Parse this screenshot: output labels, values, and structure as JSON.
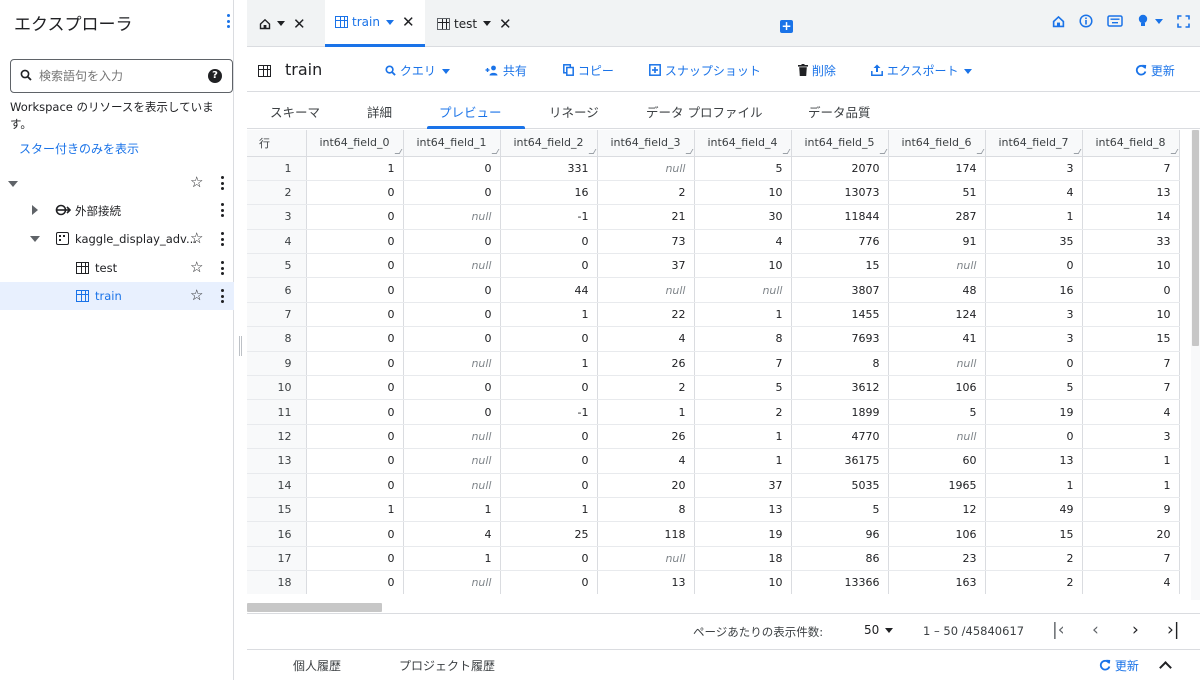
{
  "explorer": {
    "title": "エクスプローラ",
    "search_placeholder": "検索語句を入力",
    "workspace_text": "Workspace のリソースを表示しています。",
    "starred_link": "スター付きのみを表示",
    "tree": [
      {
        "label": "",
        "level": 0,
        "expanded": true
      },
      {
        "label": "外部接続",
        "level": 1,
        "expanded": false
      },
      {
        "label": "kaggle_display_adv...",
        "level": 1,
        "expanded": true
      },
      {
        "label": "test",
        "level": 2
      },
      {
        "label": "train",
        "level": 2,
        "selected": true
      }
    ]
  },
  "tabs": [
    {
      "label": "",
      "icon": "home-icon"
    },
    {
      "label": "train",
      "active": true
    },
    {
      "label": "test"
    }
  ],
  "toolbar": {
    "title": "train",
    "query": "クエリ",
    "share": "共有",
    "copy": "コピー",
    "snapshot": "スナップショット",
    "delete": "削除",
    "export": "エクスポート",
    "refresh": "更新"
  },
  "subtabs": [
    "スキーマ",
    "詳細",
    "プレビュー",
    "リネージ",
    "データ プロファイル",
    "データ品質"
  ],
  "active_subtab": "プレビュー",
  "grid": {
    "row_header": "行",
    "columns": [
      "int64_field_0",
      "int64_field_1",
      "int64_field_2",
      "int64_field_3",
      "int64_field_4",
      "int64_field_5",
      "int64_field_6",
      "int64_field_7",
      "int64_field_8"
    ],
    "rows": [
      [
        1,
        "1",
        "0",
        "331",
        "null",
        "5",
        "2070",
        "174",
        "3",
        "7"
      ],
      [
        2,
        "0",
        "0",
        "16",
        "2",
        "10",
        "13073",
        "51",
        "4",
        "13"
      ],
      [
        3,
        "0",
        "null",
        "-1",
        "21",
        "30",
        "11844",
        "287",
        "1",
        "14"
      ],
      [
        4,
        "0",
        "0",
        "0",
        "73",
        "4",
        "776",
        "91",
        "35",
        "33"
      ],
      [
        5,
        "0",
        "null",
        "0",
        "37",
        "10",
        "15",
        "null",
        "0",
        "10"
      ],
      [
        6,
        "0",
        "0",
        "44",
        "null",
        "null",
        "3807",
        "48",
        "16",
        "0"
      ],
      [
        7,
        "0",
        "0",
        "1",
        "22",
        "1",
        "1455",
        "124",
        "3",
        "10"
      ],
      [
        8,
        "0",
        "0",
        "0",
        "4",
        "8",
        "7693",
        "41",
        "3",
        "15"
      ],
      [
        9,
        "0",
        "null",
        "1",
        "26",
        "7",
        "8",
        "null",
        "0",
        "7"
      ],
      [
        10,
        "0",
        "0",
        "0",
        "2",
        "5",
        "3612",
        "106",
        "5",
        "7"
      ],
      [
        11,
        "0",
        "0",
        "-1",
        "1",
        "2",
        "1899",
        "5",
        "19",
        "4"
      ],
      [
        12,
        "0",
        "null",
        "0",
        "26",
        "1",
        "4770",
        "null",
        "0",
        "3"
      ],
      [
        13,
        "0",
        "null",
        "0",
        "4",
        "1",
        "36175",
        "60",
        "13",
        "1"
      ],
      [
        14,
        "0",
        "null",
        "0",
        "20",
        "37",
        "5035",
        "1965",
        "1",
        "1"
      ],
      [
        15,
        "1",
        "1",
        "1",
        "8",
        "13",
        "5",
        "12",
        "49",
        "9"
      ],
      [
        16,
        "0",
        "4",
        "25",
        "118",
        "19",
        "96",
        "106",
        "15",
        "20"
      ],
      [
        17,
        "0",
        "1",
        "0",
        "null",
        "18",
        "86",
        "23",
        "2",
        "7"
      ],
      [
        18,
        "0",
        "null",
        "0",
        "13",
        "10",
        "13366",
        "163",
        "2",
        "4"
      ]
    ]
  },
  "pager": {
    "per_page_label": "ページあたりの表示件数:",
    "page_size": "50",
    "range": "1 – 50 /45840617"
  },
  "bottom": {
    "personal_history": "個人履歴",
    "project_history": "プロジェクト履歴",
    "refresh": "更新"
  },
  "colors": {
    "accent": "#1a73e8",
    "selected_bg": "#e8f0fe"
  }
}
